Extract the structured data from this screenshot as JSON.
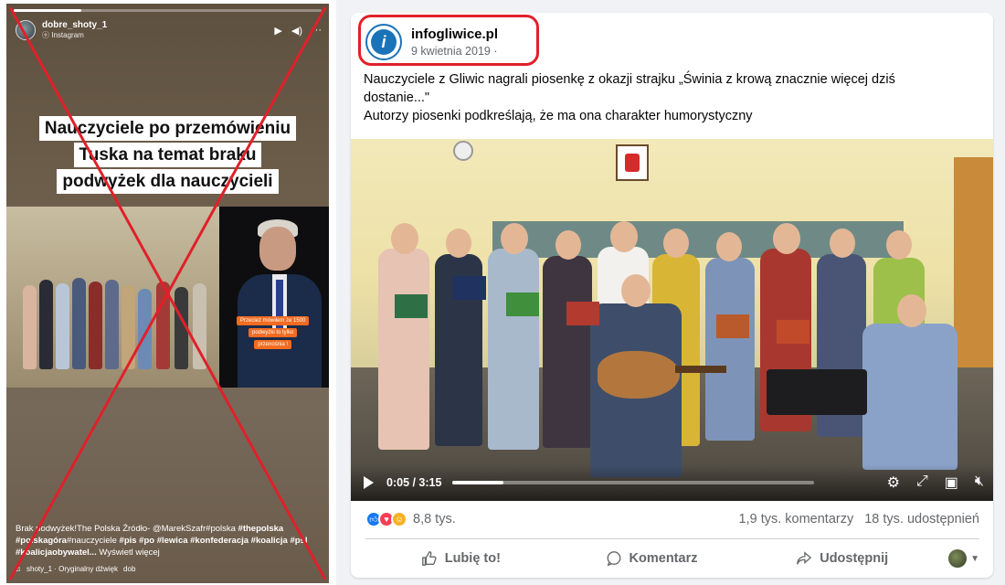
{
  "instagram": {
    "username": "dobre_shoty_1",
    "source": "Instagram",
    "headline_lines": [
      "Nauczyciele po przemówieniu",
      "Tuska na temat braku",
      "podwyżek dla nauczycieli"
    ],
    "photo_labels": [
      "Przecież mówiłem że 1500",
      "podwyżki to tylko",
      "przenośnia !"
    ],
    "caption_plain": "Brak podwyżek!The Polska Źródło- @MarekSzafr#polska ",
    "caption_bold1": "#thepolska",
    "caption_line2_bold": "#polskagóra",
    "caption_line2": "#nauczyciele ",
    "caption_tags": "#pis #po #lewica #konfederacja #koalicja #psl",
    "caption_line3_bold": "#koalicjaobywatel...",
    "caption_more": " Wyświetl więcej",
    "audio_text": "shoty_1 · Oryginalny dźwięk",
    "audio_extra": "dob",
    "cross_color": "#e0202a"
  },
  "facebook": {
    "page_name": "infogliwice.pl",
    "date": "9 kwietnia 2019 ·",
    "text_line1": "Nauczyciele z Gliwic nagrali piosenkę z okazji strajku „Świnia z krową znacznie więcej dziś",
    "text_line2": "dostanie...\"",
    "text_line3": "Autorzy piosenki podkreślają, że ma ona charakter humorystyczny",
    "video": {
      "time": "0:05 / 3:15",
      "progress": 0.14,
      "icons": [
        "gear-icon",
        "fullscreen-icon",
        "pip-icon",
        "mute-icon"
      ]
    },
    "reactions_count": "8,8 tys.",
    "comments": "1,9 tys. komentarzy",
    "shares": "18 tys. udostępnień",
    "actions": {
      "like": "Lubię to!",
      "comment": "Komentarz",
      "share": "Udostępnij"
    },
    "highlight_color": "#e0202a"
  }
}
